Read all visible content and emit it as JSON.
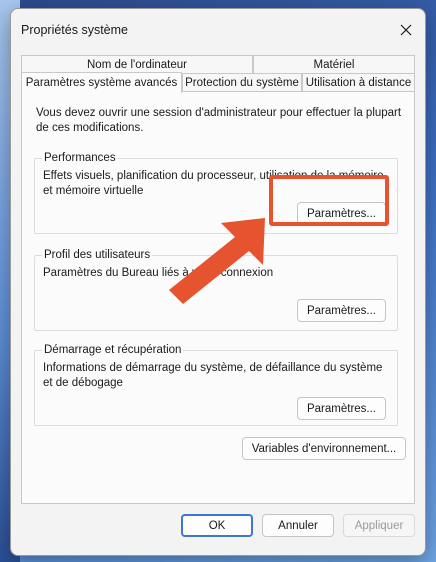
{
  "window": {
    "title": "Propriétés système"
  },
  "tabs": {
    "row1": [
      "Nom de l'ordinateur",
      "Matériel"
    ],
    "row2": [
      "Paramètres système avancés",
      "Protection du système",
      "Utilisation à distance"
    ],
    "active": "Paramètres système avancés"
  },
  "intro": "Vous devez ouvrir une session d'administrateur pour effectuer la plupart de ces modifications.",
  "groups": {
    "performance": {
      "title": "Performances",
      "description": "Effets visuels, planification du processeur, utilisation de la mémoire et mémoire virtuelle",
      "button": "Paramètres..."
    },
    "profile": {
      "title": "Profil des utilisateurs",
      "description": "Paramètres du Bureau liés à votre connexion",
      "button": "Paramètres..."
    },
    "startup": {
      "title": "Démarrage et récupération",
      "description": "Informations de démarrage du système, de défaillance du système et de débogage",
      "button": "Paramètres..."
    }
  },
  "env_button": "Variables d'environnement...",
  "footer": {
    "ok": "OK",
    "cancel": "Annuler",
    "apply": "Appliquer"
  },
  "colors": {
    "annotation": "#e5532f",
    "focus": "#3a78d6"
  },
  "icons": {
    "close": "close-icon",
    "annotation_arrow": "arrow-icon"
  }
}
